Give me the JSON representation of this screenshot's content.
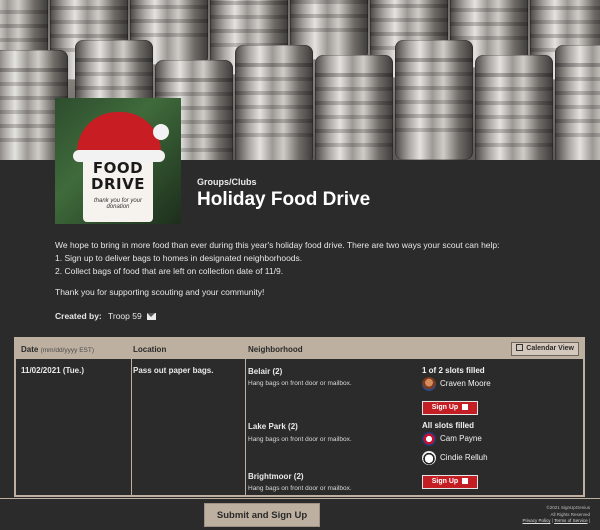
{
  "header": {
    "category": "Groups/Clubs",
    "title": "Holiday Food Drive",
    "thumbnail": {
      "line1": "FOOD",
      "line2": "DRIVE",
      "tagline": "thank you for your donation"
    }
  },
  "description": {
    "lines": [
      "We hope to bring in more food than ever during this year's holiday food drive.  There are two ways your scout can help:",
      "1. Sign up to deliver bags to homes in designated neighborhoods.",
      "2. Collect bags of food that are left on collection date of 11/9."
    ],
    "thanks": "Thank you for supporting scouting and your community!",
    "created_by_label": "Created by:",
    "created_by_value": "Troop 59"
  },
  "table": {
    "headers": {
      "date": "Date",
      "date_hint": "(mm/dd/yyyy EST)",
      "location": "Location",
      "neighborhood": "Neighborhood",
      "calendar_view": "Calendar View"
    },
    "row": {
      "date": "11/02/2021 (Tue.)",
      "location": "Pass out paper bags.",
      "neighborhoods": [
        {
          "name": "Belair (2)",
          "note": "Hang bags on front door or mailbox.",
          "status": "1 of 2 slots filled",
          "people": [
            "Craven Moore"
          ],
          "button": "Sign Up"
        },
        {
          "name": "Lake Park (2)",
          "note": "Hang bags on front door or mailbox.",
          "status": "All slots filled",
          "people": [
            "Cam Payne",
            "Cindie Relluh"
          ]
        },
        {
          "name": "Brightmoor (2)",
          "note": "Hang bags on front door or mailbox.",
          "button": "Sign Up"
        }
      ]
    }
  },
  "footer": {
    "submit": "Submit and Sign Up",
    "copyright": "©2021 SignUpGenius",
    "rights": "All Rights Reserved",
    "privacy": "Privacy Policy",
    "terms": "Terms of Service"
  },
  "colors": {
    "accent": "#bdb0a0",
    "background": "#2b2b2b",
    "signup": "#c41e25"
  }
}
